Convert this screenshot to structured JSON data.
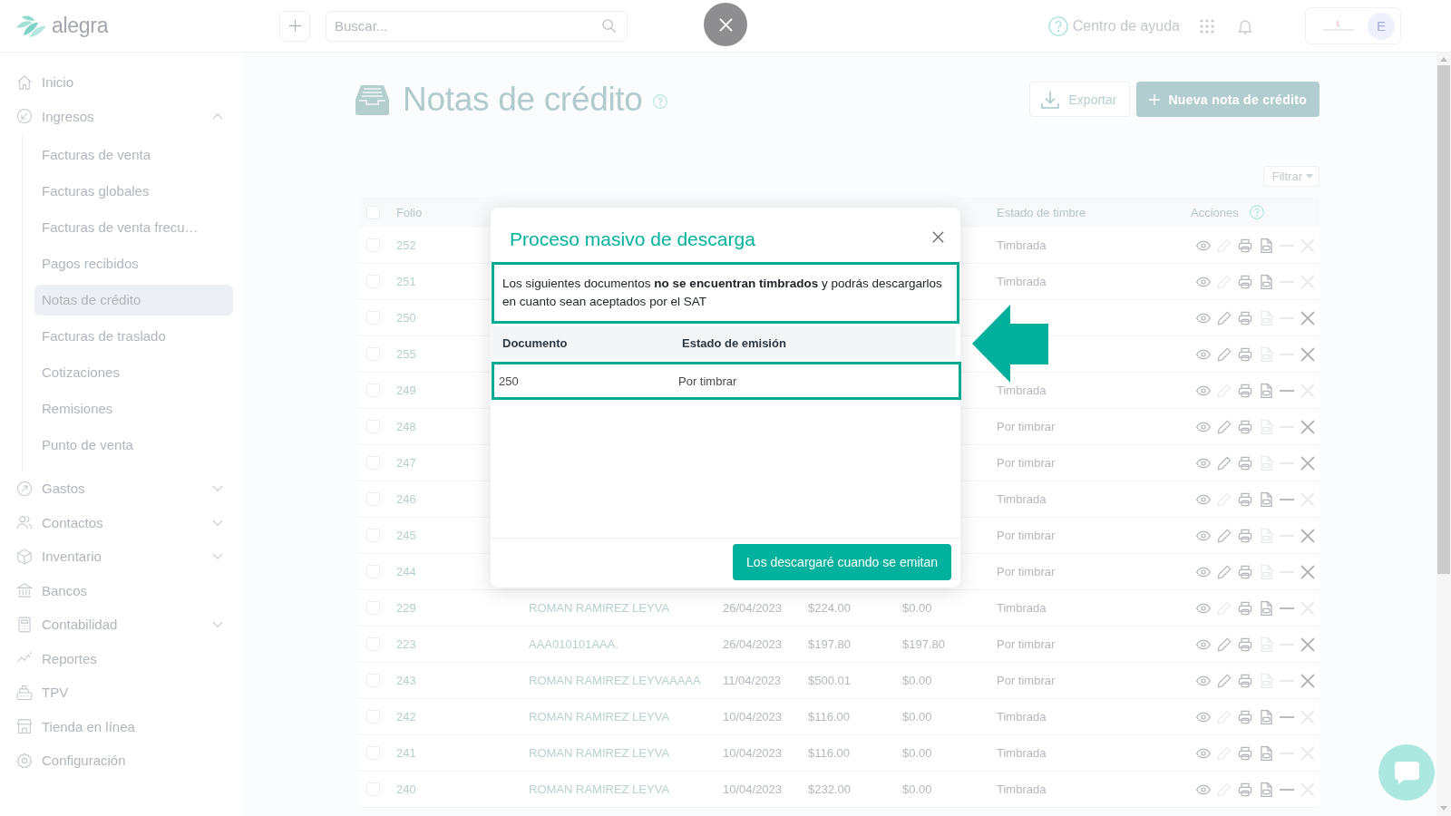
{
  "topbar": {
    "logo_text": "alegra",
    "search": {
      "placeholder": "Buscar..."
    },
    "help_link": "Centro de ayuda",
    "avatar_initial": "E"
  },
  "sidebar": {
    "items": [
      {
        "label": "Inicio",
        "selected": false
      },
      {
        "label": "Ingresos",
        "selected": false,
        "expanded": true,
        "children": [
          {
            "label": "Facturas de venta",
            "selected": false
          },
          {
            "label": "Facturas globales",
            "selected": false
          },
          {
            "label": "Facturas de venta frecu…",
            "selected": false
          },
          {
            "label": "Pagos recibidos",
            "selected": false
          },
          {
            "label": "Notas de crédito",
            "selected": true
          },
          {
            "label": "Facturas de traslado",
            "selected": false
          },
          {
            "label": "Cotizaciones",
            "selected": false
          },
          {
            "label": "Remisiones",
            "selected": false
          },
          {
            "label": "Punto de venta",
            "selected": false
          }
        ]
      },
      {
        "label": "Gastos",
        "selected": false,
        "expanded": false
      },
      {
        "label": "Contactos",
        "selected": false,
        "expanded": false
      },
      {
        "label": "Inventario",
        "selected": false,
        "expanded": false
      },
      {
        "label": "Bancos",
        "selected": false
      },
      {
        "label": "Contabilidad",
        "selected": false,
        "expanded": false
      },
      {
        "label": "Reportes",
        "selected": false
      },
      {
        "label": "TPV",
        "selected": false
      },
      {
        "label": "Tienda en línea",
        "selected": false
      },
      {
        "label": "Configuración",
        "selected": false
      }
    ]
  },
  "page": {
    "title": "Notas de crédito",
    "export_button": "Exportar",
    "new_button": "Nueva nota de crédito",
    "filter_button": "Filtrar"
  },
  "table": {
    "header": {
      "checked": false,
      "folio": "Folio",
      "estado_de_timbre": "Estado de timbre",
      "acciones": "Acciones"
    },
    "rows": [
      {
        "checked": false,
        "folio": "252",
        "estado_de_timbre": "Timbrada",
        "actions": [
          {
            "kind": "view",
            "disabled": false
          },
          {
            "kind": "edit",
            "disabled": true
          },
          {
            "kind": "print",
            "disabled": false
          },
          {
            "kind": "xml",
            "disabled": false
          },
          {
            "kind": "void",
            "disabled": true
          },
          {
            "kind": "cancel",
            "disabled": true
          }
        ]
      },
      {
        "checked": false,
        "folio": "251",
        "estado_de_timbre": "Timbrada",
        "actions": [
          {
            "kind": "view",
            "disabled": false
          },
          {
            "kind": "edit",
            "disabled": true
          },
          {
            "kind": "print",
            "disabled": false
          },
          {
            "kind": "xml",
            "disabled": false
          },
          {
            "kind": "void",
            "disabled": true
          },
          {
            "kind": "cancel",
            "disabled": true
          }
        ]
      },
      {
        "checked": false,
        "folio": "250",
        "actions": [
          {
            "kind": "view",
            "disabled": false
          },
          {
            "kind": "edit",
            "disabled": false
          },
          {
            "kind": "print",
            "disabled": false
          },
          {
            "kind": "xml",
            "disabled": true
          },
          {
            "kind": "void",
            "disabled": true
          },
          {
            "kind": "cancel",
            "disabled": false
          }
        ]
      },
      {
        "checked": false,
        "folio": "255",
        "actions": [
          {
            "kind": "view",
            "disabled": false
          },
          {
            "kind": "edit",
            "disabled": false
          },
          {
            "kind": "print",
            "disabled": false
          },
          {
            "kind": "xml",
            "disabled": true
          },
          {
            "kind": "void",
            "disabled": true
          },
          {
            "kind": "cancel",
            "disabled": false
          }
        ]
      },
      {
        "checked": false,
        "folio": "249",
        "estado_de_timbre": "Timbrada",
        "actions": [
          {
            "kind": "view",
            "disabled": false
          },
          {
            "kind": "edit",
            "disabled": true
          },
          {
            "kind": "print",
            "disabled": false
          },
          {
            "kind": "xml",
            "disabled": false
          },
          {
            "kind": "void",
            "disabled": false
          },
          {
            "kind": "cancel",
            "disabled": true
          }
        ]
      },
      {
        "checked": false,
        "folio": "248",
        "estado_de_timbre": "Por timbrar",
        "actions": [
          {
            "kind": "view",
            "disabled": false
          },
          {
            "kind": "edit",
            "disabled": false
          },
          {
            "kind": "print",
            "disabled": false
          },
          {
            "kind": "xml",
            "disabled": true
          },
          {
            "kind": "void",
            "disabled": true
          },
          {
            "kind": "cancel",
            "disabled": false
          }
        ]
      },
      {
        "checked": false,
        "folio": "247",
        "estado_de_timbre": "Por timbrar",
        "actions": [
          {
            "kind": "view",
            "disabled": false
          },
          {
            "kind": "edit",
            "disabled": false
          },
          {
            "kind": "print",
            "disabled": false
          },
          {
            "kind": "xml",
            "disabled": true
          },
          {
            "kind": "void",
            "disabled": true
          },
          {
            "kind": "cancel",
            "disabled": false
          }
        ]
      },
      {
        "checked": false,
        "folio": "246",
        "estado_de_timbre": "Timbrada",
        "actions": [
          {
            "kind": "view",
            "disabled": false
          },
          {
            "kind": "edit",
            "disabled": true
          },
          {
            "kind": "print",
            "disabled": false
          },
          {
            "kind": "xml",
            "disabled": false
          },
          {
            "kind": "void",
            "disabled": false
          },
          {
            "kind": "cancel",
            "disabled": true
          }
        ]
      },
      {
        "checked": false,
        "folio": "245",
        "estado_de_timbre": "Por timbrar",
        "actions": [
          {
            "kind": "view",
            "disabled": false
          },
          {
            "kind": "edit",
            "disabled": false
          },
          {
            "kind": "print",
            "disabled": false
          },
          {
            "kind": "xml",
            "disabled": true
          },
          {
            "kind": "void",
            "disabled": true
          },
          {
            "kind": "cancel",
            "disabled": false
          }
        ]
      },
      {
        "checked": false,
        "folio": "244",
        "estado_de_timbre": "Por timbrar",
        "actions": [
          {
            "kind": "view",
            "disabled": false
          },
          {
            "kind": "edit",
            "disabled": false
          },
          {
            "kind": "print",
            "disabled": false
          },
          {
            "kind": "xml",
            "disabled": true
          },
          {
            "kind": "void",
            "disabled": true
          },
          {
            "kind": "cancel",
            "disabled": false
          }
        ]
      },
      {
        "checked": false,
        "folio": "229",
        "column_3": "ROMAN RAMIREZ LEYVA",
        "column_4": "26/04/2023",
        "column_5": "$224.00",
        "column_6": "$0.00",
        "estado_de_timbre": "Timbrada",
        "actions": [
          {
            "kind": "view",
            "disabled": false
          },
          {
            "kind": "edit",
            "disabled": true
          },
          {
            "kind": "print",
            "disabled": false
          },
          {
            "kind": "xml",
            "disabled": false
          },
          {
            "kind": "void",
            "disabled": false
          },
          {
            "kind": "cancel",
            "disabled": true
          }
        ]
      },
      {
        "checked": false,
        "folio": "223",
        "column_3": "AAA010101AAA.",
        "column_4": "26/04/2023",
        "column_5": "$197.80",
        "column_6": "$197.80",
        "estado_de_timbre": "Por timbrar",
        "actions": [
          {
            "kind": "view",
            "disabled": false
          },
          {
            "kind": "edit",
            "disabled": false
          },
          {
            "kind": "print",
            "disabled": false
          },
          {
            "kind": "xml",
            "disabled": true
          },
          {
            "kind": "void",
            "disabled": true
          },
          {
            "kind": "cancel",
            "disabled": false
          }
        ]
      },
      {
        "checked": false,
        "folio": "243",
        "column_3": "ROMAN RAMIREZ LEYVAAAAA",
        "column_4": "11/04/2023",
        "column_5": "$500.01",
        "column_6": "$0.00",
        "estado_de_timbre": "Por timbrar",
        "actions": [
          {
            "kind": "view",
            "disabled": false
          },
          {
            "kind": "edit",
            "disabled": false
          },
          {
            "kind": "print",
            "disabled": false
          },
          {
            "kind": "xml",
            "disabled": true
          },
          {
            "kind": "void",
            "disabled": true
          },
          {
            "kind": "cancel",
            "disabled": false
          }
        ]
      },
      {
        "checked": false,
        "folio": "242",
        "column_3": "ROMAN RAMIREZ LEYVA",
        "column_4": "10/04/2023",
        "column_5": "$116.00",
        "column_6": "$0.00",
        "estado_de_timbre": "Timbrada",
        "actions": [
          {
            "kind": "view",
            "disabled": false
          },
          {
            "kind": "edit",
            "disabled": true
          },
          {
            "kind": "print",
            "disabled": false
          },
          {
            "kind": "xml",
            "disabled": false
          },
          {
            "kind": "void",
            "disabled": false
          },
          {
            "kind": "cancel",
            "disabled": true
          }
        ]
      },
      {
        "checked": false,
        "folio": "241",
        "column_3": "ROMAN RAMIREZ LEYVA",
        "column_4": "10/04/2023",
        "column_5": "$116.00",
        "column_6": "$0.00",
        "estado_de_timbre": "Timbrada",
        "actions": [
          {
            "kind": "view",
            "disabled": false
          },
          {
            "kind": "edit",
            "disabled": true
          },
          {
            "kind": "print",
            "disabled": false
          },
          {
            "kind": "xml",
            "disabled": false
          },
          {
            "kind": "void",
            "disabled": true
          },
          {
            "kind": "cancel",
            "disabled": true
          }
        ]
      },
      {
        "checked": false,
        "folio": "240",
        "column_3": "ROMAN RAMIREZ LEYVA",
        "column_4": "10/04/2023",
        "column_5": "$232.00",
        "column_6": "$0.00",
        "estado_de_timbre": "Timbrada",
        "actions": [
          {
            "kind": "view",
            "disabled": false
          },
          {
            "kind": "edit",
            "disabled": true
          },
          {
            "kind": "print",
            "disabled": false
          },
          {
            "kind": "xml",
            "disabled": false
          },
          {
            "kind": "void",
            "disabled": false
          },
          {
            "kind": "cancel",
            "disabled": true
          }
        ]
      }
    ]
  },
  "modal": {
    "title": "Proceso masivo de descarga",
    "message": "Los siguientes documentos **no se encuentran timbrados** y podrás descargarlos en cuanto sean aceptados por el SAT",
    "message_highlighted": true,
    "columns": [
      "Documento",
      "Estado de emisión"
    ],
    "rows": [
      {
        "documento": "250",
        "estado_de_emision": "Por timbrar",
        "highlighted": true
      }
    ],
    "button": "Los descargaré cuando se emitan"
  }
}
